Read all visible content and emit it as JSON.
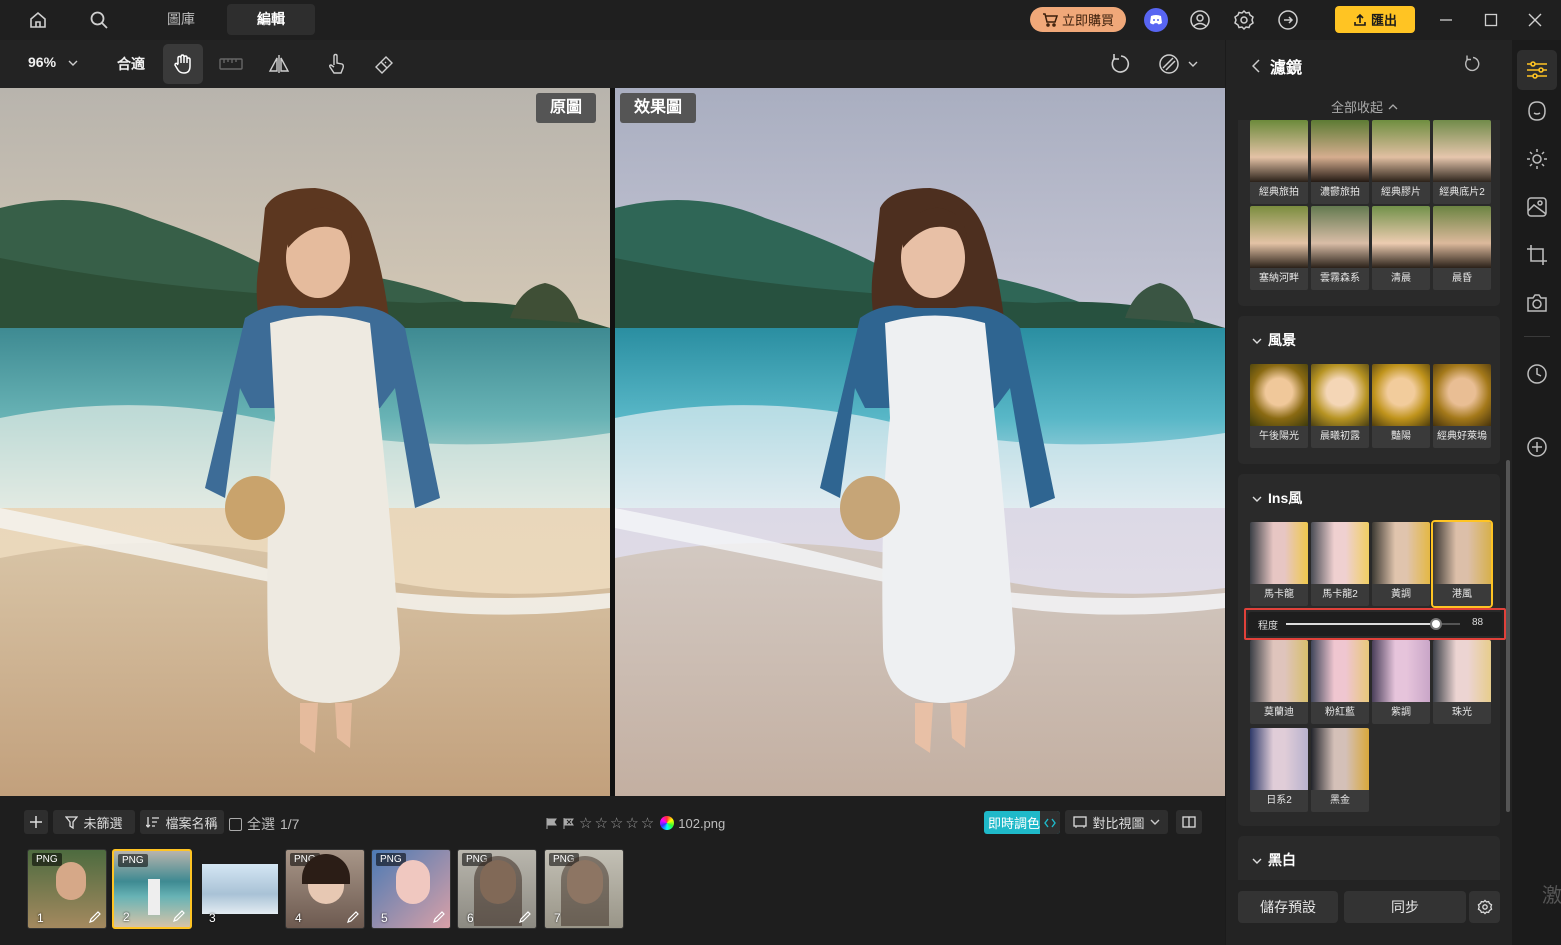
{
  "titlebar": {
    "tabs": [
      "圖庫",
      "編輯"
    ],
    "buy_label": "立即購買",
    "export_label": "匯出"
  },
  "toolbar": {
    "zoom": "96%",
    "fit_label": "合適"
  },
  "canvas": {
    "original_label": "原圖",
    "effect_label": "效果圖"
  },
  "bottombar": {
    "filter_label": "未篩選",
    "sort_label": "檔案名稱",
    "select_all_label": "全選",
    "count": "1/7",
    "filename": "102.png",
    "live_adjust_label": "即時調色",
    "compare_view_label": "對比視圖",
    "thumbnails": [
      {
        "num": "1",
        "tag": "PNG"
      },
      {
        "num": "2",
        "tag": "PNG"
      },
      {
        "num": "3",
        "tag": ""
      },
      {
        "num": "4",
        "tag": "PNG"
      },
      {
        "num": "5",
        "tag": "PNG"
      },
      {
        "num": "6",
        "tag": "PNG"
      },
      {
        "num": "7",
        "tag": "PNG"
      }
    ]
  },
  "panel": {
    "title": "濾鏡",
    "collapse_all": "全部收起",
    "group1": [
      "經典旅拍",
      "濃鬱旅拍",
      "經典膠片",
      "經典底片2",
      "塞納河畔",
      "雲霧森系",
      "清晨",
      "晨昏"
    ],
    "landscape": {
      "title": "風景",
      "items": [
        "午後陽光",
        "晨曦初露",
        "豔陽",
        "經典好萊塢"
      ]
    },
    "ins": {
      "title": "Ins風",
      "items_row1": [
        "馬卡龍",
        "馬卡龍2",
        "黃調",
        "港風"
      ],
      "intensity_label": "程度",
      "intensity_value": "88",
      "items_row2": [
        "莫蘭迪",
        "粉紅藍",
        "紫調",
        "珠光"
      ],
      "items_row3": [
        "日系2",
        "黑金"
      ]
    },
    "bw": {
      "title": "黑白"
    },
    "save_preset_label": "儲存預設",
    "sync_label": "同步"
  },
  "watermark": "激",
  "colors": {
    "accent_yellow": "#ffc423",
    "buy_orange": "#f0a879",
    "live_cyan": "#1fb9c9",
    "discord": "#5865f2"
  }
}
